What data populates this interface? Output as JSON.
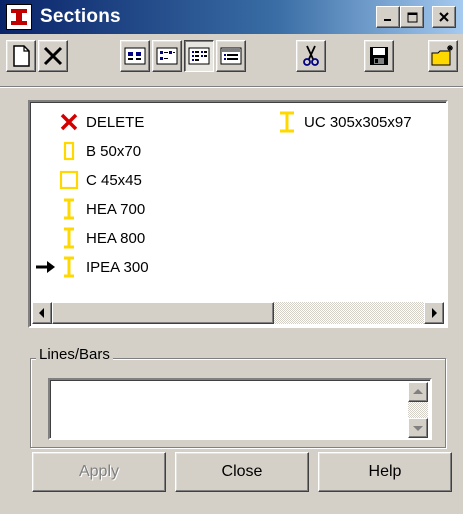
{
  "window": {
    "title": "Sections",
    "title_icon": "i-beam-icon",
    "controls": {
      "minimize": "_",
      "maximize": "□",
      "close": "✕"
    }
  },
  "toolbar": {
    "buttons": [
      {
        "name": "new-button",
        "icon": "new-document-icon"
      },
      {
        "name": "delete-button",
        "icon": "delete-x-icon"
      },
      {
        "name": "large-icons-view-button",
        "icon": "large-icons-view-icon"
      },
      {
        "name": "small-icons-view-button",
        "icon": "small-icons-view-icon"
      },
      {
        "name": "list-view-button",
        "icon": "list-view-icon",
        "pressed": true
      },
      {
        "name": "details-view-button",
        "icon": "details-view-icon"
      },
      {
        "name": "cut-button",
        "icon": "scissors-icon"
      },
      {
        "name": "save-button",
        "icon": "floppy-disk-icon"
      },
      {
        "name": "new-folder-button",
        "icon": "new-folder-icon"
      }
    ]
  },
  "sections": {
    "items": [
      {
        "label": "DELETE",
        "icon": "red-x-icon"
      },
      {
        "label": "B 50x70",
        "icon": "rectangle-section-icon"
      },
      {
        "label": "C 45x45",
        "icon": "square-section-icon"
      },
      {
        "label": "HEA 700",
        "icon": "i-section-icon"
      },
      {
        "label": "HEA 800",
        "icon": "i-section-icon"
      },
      {
        "label": "IPEA 300",
        "icon": "i-section-icon",
        "current": true,
        "marker": "arrow-right-icon"
      },
      {
        "label": "UC 305x305x97",
        "icon": "i-section-icon"
      }
    ]
  },
  "lines_bars": {
    "label": "Lines/Bars",
    "value": ""
  },
  "buttons": {
    "apply": "Apply",
    "close": "Close",
    "help": "Help"
  },
  "colors": {
    "title_gradient_start": "#0a246a",
    "section_icon": "#ffd800",
    "delete_icon": "#d40000",
    "face": "#d4d0c8"
  }
}
